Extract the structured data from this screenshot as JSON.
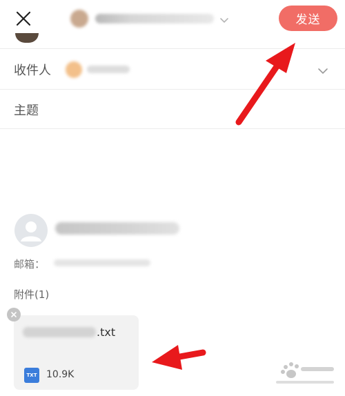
{
  "header": {
    "close_icon": "close-icon",
    "chevron_icon": "chevron-down-icon",
    "send_label": "发送",
    "send_color": "#f16d66"
  },
  "recipient": {
    "label": "收件人",
    "chevron_icon": "chevron-down-icon"
  },
  "subject": {
    "label": "主题"
  },
  "contact": {
    "avatar_icon": "person-icon",
    "email_label": "邮箱："
  },
  "attachments": {
    "label": "附件(1)",
    "items": [
      {
        "extension": ".txt",
        "type_badge": "TXT",
        "size": "10.9K",
        "badge_color": "#3b7ddb"
      }
    ],
    "remove_icon": "close-badge-icon"
  },
  "annotations": {
    "arrow_color": "#e8191c"
  }
}
